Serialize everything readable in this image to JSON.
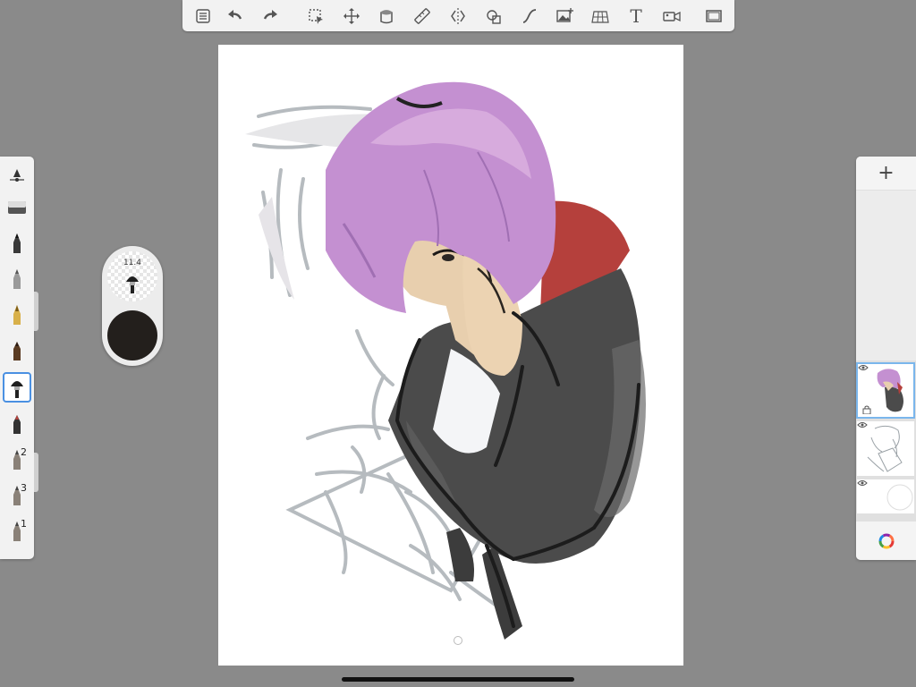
{
  "toolbar": {
    "items": [
      {
        "name": "menu-list-icon"
      },
      {
        "name": "undo-icon"
      },
      {
        "name": "redo-icon"
      },
      {
        "name": "selection-icon"
      },
      {
        "name": "transform-icon"
      },
      {
        "name": "fill-icon"
      },
      {
        "name": "ruler-icon"
      },
      {
        "name": "symmetry-icon"
      },
      {
        "name": "shape-guides-icon"
      },
      {
        "name": "curve-icon"
      },
      {
        "name": "image-import-icon"
      },
      {
        "name": "perspective-grid-icon"
      },
      {
        "name": "text-tool-icon",
        "label": "T"
      },
      {
        "name": "record-video-icon"
      },
      {
        "name": "fullscreen-icon"
      }
    ]
  },
  "brush_puck": {
    "size_label": "11.4",
    "color": "#231f1c"
  },
  "brush_library": {
    "brushes": [
      {
        "name": "brush-properties-icon",
        "number": ""
      },
      {
        "name": "eraser-brush-icon",
        "number": ""
      },
      {
        "name": "pencil-brush-icon",
        "number": ""
      },
      {
        "name": "technical-pen-brush-icon",
        "number": ""
      },
      {
        "name": "calligraphy-pen-brush-icon",
        "number": ""
      },
      {
        "name": "marker-brush-icon",
        "number": ""
      },
      {
        "name": "paint-brush-icon",
        "number": "",
        "selected": true
      },
      {
        "name": "airbrush-brush-icon",
        "number": ""
      },
      {
        "name": "pencil-2-brush-icon",
        "number": "2"
      },
      {
        "name": "pencil-3-brush-icon",
        "number": "3"
      },
      {
        "name": "pencil-1-brush-icon",
        "number": "1"
      }
    ]
  },
  "layers_panel": {
    "add_label": "+",
    "layers": [
      {
        "name": "color-layer",
        "visible": true,
        "selected": true
      },
      {
        "name": "sketch-layer",
        "visible": true,
        "selected": false
      },
      {
        "name": "background-layer",
        "visible": true,
        "selected": false
      }
    ]
  },
  "colors": {
    "accent": "#4a90e2",
    "hair": "#c490d1",
    "jacket": "#4b4b4b",
    "skin": "#e8cfae",
    "hood_red": "#b5403c"
  }
}
